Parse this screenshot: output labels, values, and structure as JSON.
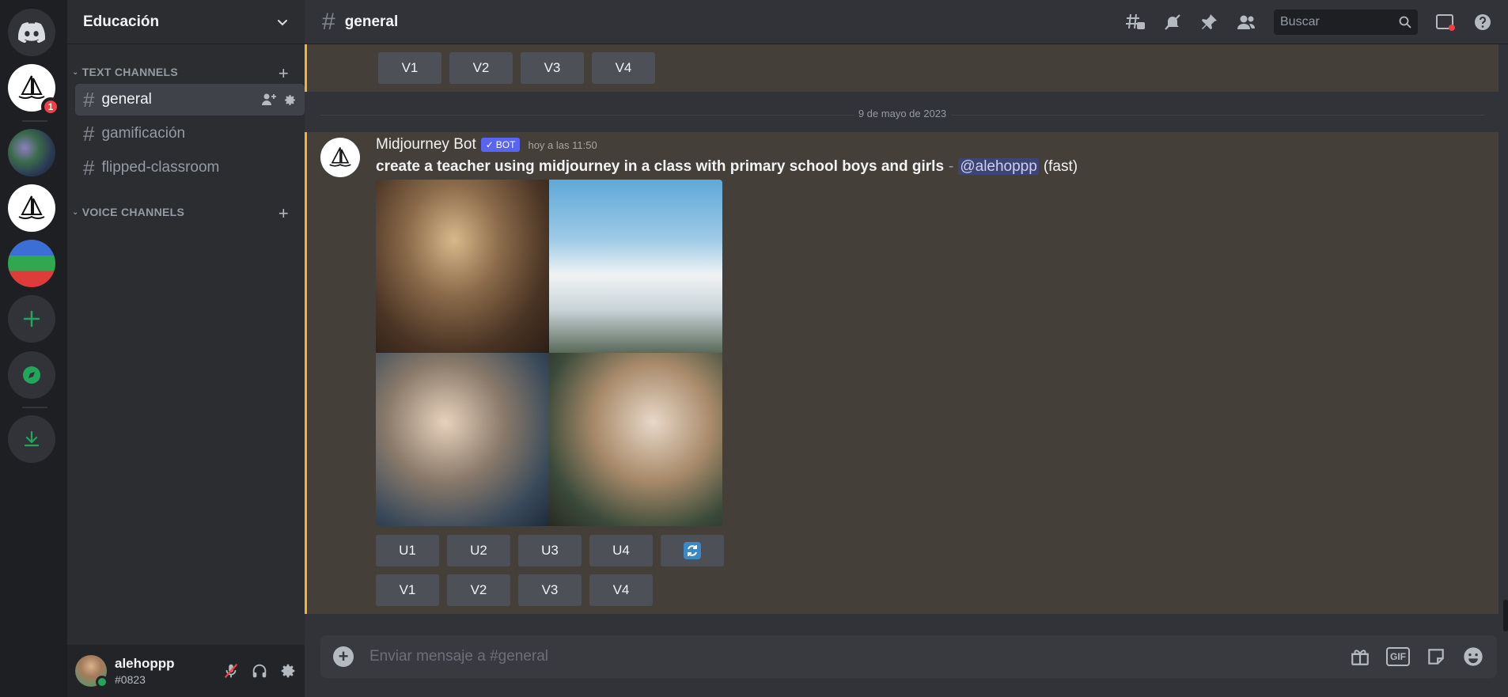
{
  "server": {
    "name": "Educación",
    "notification_count": "1"
  },
  "categories": {
    "text": "TEXT CHANNELS",
    "voice": "VOICE CHANNELS"
  },
  "channels": [
    {
      "name": "general",
      "active": true
    },
    {
      "name": "gamificación",
      "active": false
    },
    {
      "name": "flipped-classroom",
      "active": false
    }
  ],
  "header": {
    "channel": "general",
    "search_placeholder": "Buscar"
  },
  "prev_message": {
    "buttons": [
      "V1",
      "V2",
      "V3",
      "V4"
    ]
  },
  "date_divider": "9 de mayo de 2023",
  "message": {
    "author": "Midjourney Bot",
    "bot_tag": "BOT",
    "timestamp": "hoy a las 11:50",
    "prompt": "create a teacher using midjourney in a class with primary school boys and girls",
    "separator": "-",
    "mention": "@alehoppp",
    "mode": "(fast)",
    "upscale_buttons": [
      "U1",
      "U2",
      "U3",
      "U4"
    ],
    "variation_buttons": [
      "V1",
      "V2",
      "V3",
      "V4"
    ]
  },
  "composer": {
    "placeholder": "Enviar mensaje a #general"
  },
  "user": {
    "name": "alehoppp",
    "tag": "#0823"
  },
  "colors": {
    "accent": "#5865f2",
    "highlight": "#f0b232",
    "online": "#23a55a",
    "danger": "#f23f43"
  }
}
